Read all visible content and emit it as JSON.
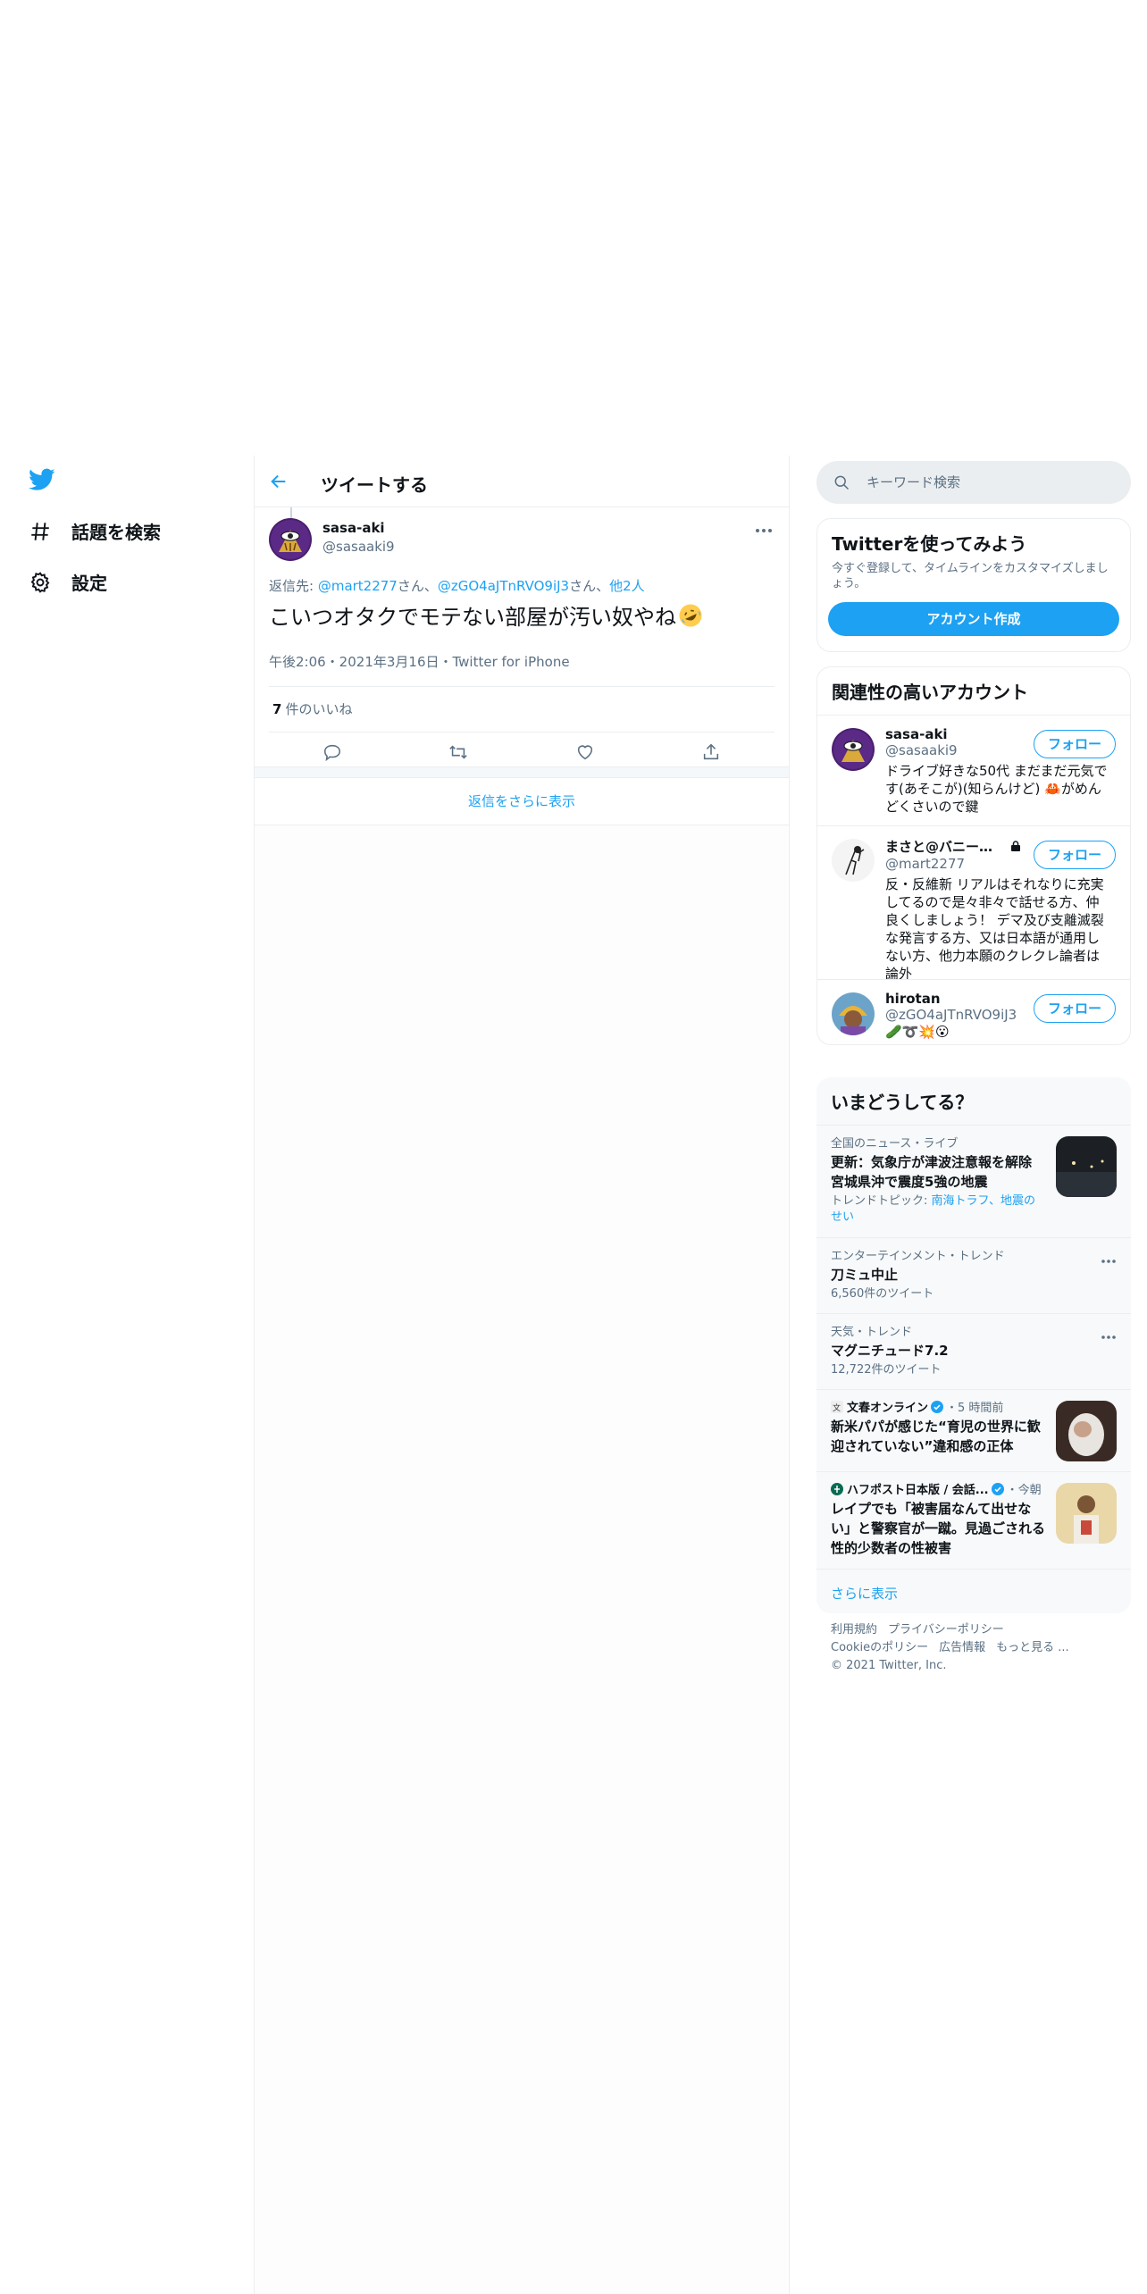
{
  "nav": {
    "items": [
      {
        "icon": "hashtag-icon",
        "label": "話題を検索"
      },
      {
        "icon": "gear-icon",
        "label": "設定"
      }
    ]
  },
  "header": {
    "title": "ツイートする"
  },
  "tweet": {
    "author_name": "sasa-aki",
    "author_handle": "@sasaaki9",
    "reply_prefix": "返信先: ",
    "reply_user1": "@mart2277",
    "reply_san1": "さん、",
    "reply_user2": "@zGO4aJTnRVO9iJ3",
    "reply_san2": "さん、",
    "reply_others": "他2人",
    "text": "こいつオタクでモテない部屋が汚い奴やね",
    "meta": "午後2:06・2021年3月16日・Twitter for iPhone",
    "likes_count": "7",
    "likes_label": "件のいいね"
  },
  "show_more_replies": "返信をさらに表示",
  "sidebar": {
    "search_placeholder": "キーワード検索",
    "signup": {
      "title": "Twitterを使ってみよう",
      "desc": "今すぐ登録して、タイムラインをカスタマイズしましょう。",
      "button": "アカウント作成"
    },
    "related": {
      "title": "関連性の高いアカウント",
      "follow_label": "フォロー",
      "accounts": [
        {
          "name": "sasa-aki",
          "handle": "@sasaaki9",
          "bio": "ドライブ好きな50代 まだまだ元気です(あそこが)(知らんけど) 🦀がめんどくさいので鍵"
        },
        {
          "name": "まさと@バニー…",
          "handle": "@mart2277",
          "bio": "反・反維新 リアルはそれなりに充実してるので是々非々で話せる方、仲良くしましょう！ デマ及び支離滅裂な発言する方、又は日本語が通用しない方、他力本願のクレクレ論者は論外"
        },
        {
          "name": "hirotan",
          "handle": "@zGO4aJTnRVO9iJ3",
          "bio": "🥒➰💥😮"
        }
      ]
    },
    "trends": {
      "title": "いまどうしてる？",
      "items": [
        {
          "context": "全国のニュース・ライブ",
          "headline": "更新：気象庁が津波注意報を解除 宮城県沖で震度5強の地震",
          "sub_prefix": "トレンドトピック: ",
          "sub_links": "南海トラフ、地震のせい"
        },
        {
          "context": "エンターテインメント・トレンド",
          "headline": "刀ミュ中止",
          "sub": "6,560件のツイート"
        },
        {
          "context": "天気・トレンド",
          "headline": "マグニチュード7.2",
          "sub": "12,722件のツイート"
        },
        {
          "source": "文春オンライン",
          "time": "・5 時間前",
          "headline": "新米パパが感じた“育児の世界に歓迎されていない”違和感の正体"
        },
        {
          "source": "ハフポスト日本版 / 会話...",
          "time": "・今朝",
          "headline": "レイプでも「被害届なんて出せない」と警察官が一蹴。見過ごされる性的少数者の性被害"
        }
      ],
      "show_more": "さらに表示"
    },
    "footer": {
      "links": [
        "利用規約",
        "プライバシーポリシー",
        "Cookieのポリシー",
        "広告情報",
        "もっと見る ..."
      ],
      "copyright": "© 2021 Twitter, Inc."
    }
  },
  "colors": {
    "accent": "#1da1f2",
    "secondary_text": "#5b7083",
    "border": "#ebeef0"
  }
}
